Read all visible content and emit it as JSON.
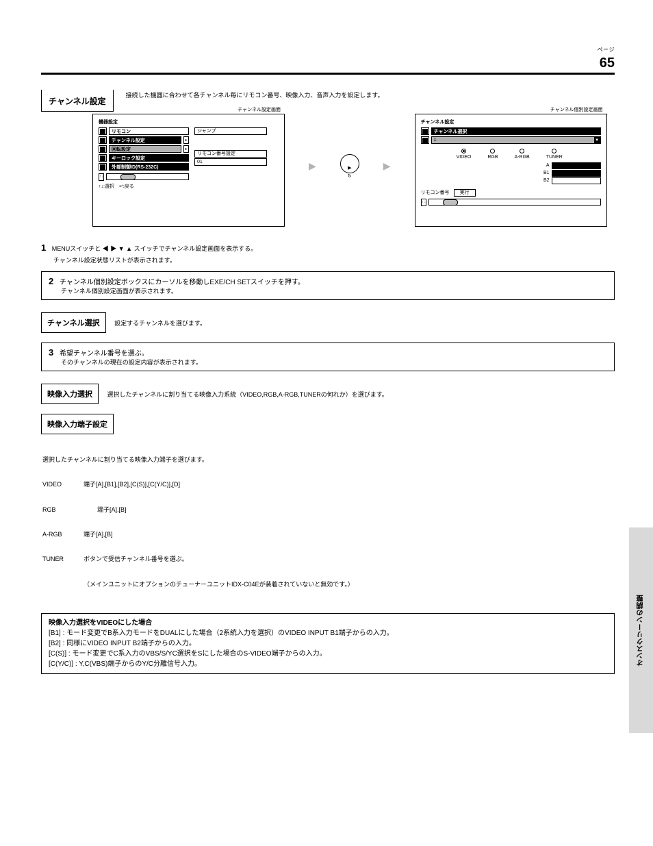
{
  "header": {
    "page_label": "ページ",
    "page_number": "65"
  },
  "side_tab": "オンスクリーンの調整",
  "intro": {
    "title": "チャンネル設定",
    "desc": "接続した機器に合わせて各チャンネル毎にリモコン番号、映像入力、音声入力を設定します。",
    "screen1_subtitle": "チャンネル設定画面",
    "screen2_subtitle": "チャンネル個別設定画面"
  },
  "screen1": {
    "title": "機器設定",
    "items": [
      "リモコン",
      "チャンネル設定",
      "回転設定",
      "キーロック設定",
      "外部制御ID(RS-232C)"
    ],
    "right": {
      "r1": "ジャンプ",
      "r2": "リモコン番号設定",
      "r3": "01"
    },
    "return": "↑↓:選択　↵:戻る"
  },
  "screen2": {
    "title": "チャンネル設定",
    "dd_label": "1",
    "dd_val": "チャンネル選択",
    "rb_labels": [
      "VIDEO",
      "RGB",
      "A-RGB",
      "TUNER"
    ],
    "right_labels": [
      "A",
      "B1",
      "B2"
    ],
    "exec": "実行",
    "right_val": "リモコン番号"
  },
  "body": {
    "p1": "MENUスイッチと ◀ ▶ ▼ ▲ スイッチでチャンネル設定画面を表示する。",
    "p2": "チャンネル設定状態リストが表示されます。",
    "box1": [
      "チャンネル個別設定ボックスにカーソルを移動しEXE/CH SETスイッチを押す。",
      "チャンネル個別設定画面が表示されます。"
    ],
    "lbl1": "チャンネル選択",
    "lbl1_sub": "設定するチャンネルを選びます。",
    "box2": [
      "希望チャンネル番号を選ぶ。",
      "そのチャンネルの現在の設定内容が表示されます。"
    ],
    "lbl2": "映像入力選択",
    "lbl2_sub": "選択したチャンネルに割り当てる映像入力系統（VIDEO,RGB,A-RGB,TUNERの何れか）を選びます。",
    "lbl3": "映像入力端子設定",
    "lbl3_sub_lines": [
      "選択したチャンネルに割り当てる映像入力端子を選びます。",
      "VIDEO\t\t端子[A],[B1],[B2],[C(S)],[C(Y/C)],[D]",
      "RGB\t\t\t端子[A],[B]",
      "A-RGB\t\t端子[A],[B]",
      "TUNER\t\tボタンで受信チャンネル番号を選ぶ。",
      "\t\t\t（メインユニットにオプションのチューナーユニットIDX-C04Eが装着されていないと無効です。）"
    ],
    "box3": [
      "映像入力選択をVIDEOにした場合",
      "[B1] : モード変更でB系入力モードをDUALにした場合（2系統入力を選択）のVIDEO INPUT B1端子からの入力。",
      "[B2] : 同様にVIDEO INPUT B2端子からの入力。",
      "[C(S)] : モード変更でC系入力のVBS/S/YC選択をSにした場合のS-VIDEO端子からの入力。",
      "[C(Y/C)] : Y,C(VBS)端子からのY/C分離信号入力。"
    ]
  },
  "icons": {
    "left": "◀",
    "right": "▶",
    "down": "▼",
    "up": "▲"
  }
}
